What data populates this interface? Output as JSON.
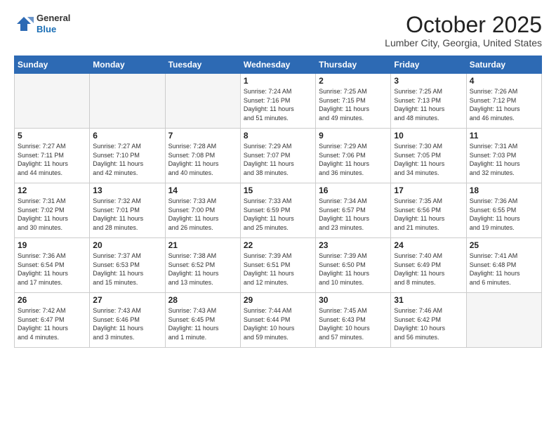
{
  "header": {
    "logo": {
      "general": "General",
      "blue": "Blue"
    },
    "title": "October 2025",
    "location": "Lumber City, Georgia, United States"
  },
  "days_of_week": [
    "Sunday",
    "Monday",
    "Tuesday",
    "Wednesday",
    "Thursday",
    "Friday",
    "Saturday"
  ],
  "weeks": [
    [
      {
        "day": "",
        "info": ""
      },
      {
        "day": "",
        "info": ""
      },
      {
        "day": "",
        "info": ""
      },
      {
        "day": "1",
        "info": "Sunrise: 7:24 AM\nSunset: 7:16 PM\nDaylight: 11 hours\nand 51 minutes."
      },
      {
        "day": "2",
        "info": "Sunrise: 7:25 AM\nSunset: 7:15 PM\nDaylight: 11 hours\nand 49 minutes."
      },
      {
        "day": "3",
        "info": "Sunrise: 7:25 AM\nSunset: 7:13 PM\nDaylight: 11 hours\nand 48 minutes."
      },
      {
        "day": "4",
        "info": "Sunrise: 7:26 AM\nSunset: 7:12 PM\nDaylight: 11 hours\nand 46 minutes."
      }
    ],
    [
      {
        "day": "5",
        "info": "Sunrise: 7:27 AM\nSunset: 7:11 PM\nDaylight: 11 hours\nand 44 minutes."
      },
      {
        "day": "6",
        "info": "Sunrise: 7:27 AM\nSunset: 7:10 PM\nDaylight: 11 hours\nand 42 minutes."
      },
      {
        "day": "7",
        "info": "Sunrise: 7:28 AM\nSunset: 7:08 PM\nDaylight: 11 hours\nand 40 minutes."
      },
      {
        "day": "8",
        "info": "Sunrise: 7:29 AM\nSunset: 7:07 PM\nDaylight: 11 hours\nand 38 minutes."
      },
      {
        "day": "9",
        "info": "Sunrise: 7:29 AM\nSunset: 7:06 PM\nDaylight: 11 hours\nand 36 minutes."
      },
      {
        "day": "10",
        "info": "Sunrise: 7:30 AM\nSunset: 7:05 PM\nDaylight: 11 hours\nand 34 minutes."
      },
      {
        "day": "11",
        "info": "Sunrise: 7:31 AM\nSunset: 7:03 PM\nDaylight: 11 hours\nand 32 minutes."
      }
    ],
    [
      {
        "day": "12",
        "info": "Sunrise: 7:31 AM\nSunset: 7:02 PM\nDaylight: 11 hours\nand 30 minutes."
      },
      {
        "day": "13",
        "info": "Sunrise: 7:32 AM\nSunset: 7:01 PM\nDaylight: 11 hours\nand 28 minutes."
      },
      {
        "day": "14",
        "info": "Sunrise: 7:33 AM\nSunset: 7:00 PM\nDaylight: 11 hours\nand 26 minutes."
      },
      {
        "day": "15",
        "info": "Sunrise: 7:33 AM\nSunset: 6:59 PM\nDaylight: 11 hours\nand 25 minutes."
      },
      {
        "day": "16",
        "info": "Sunrise: 7:34 AM\nSunset: 6:57 PM\nDaylight: 11 hours\nand 23 minutes."
      },
      {
        "day": "17",
        "info": "Sunrise: 7:35 AM\nSunset: 6:56 PM\nDaylight: 11 hours\nand 21 minutes."
      },
      {
        "day": "18",
        "info": "Sunrise: 7:36 AM\nSunset: 6:55 PM\nDaylight: 11 hours\nand 19 minutes."
      }
    ],
    [
      {
        "day": "19",
        "info": "Sunrise: 7:36 AM\nSunset: 6:54 PM\nDaylight: 11 hours\nand 17 minutes."
      },
      {
        "day": "20",
        "info": "Sunrise: 7:37 AM\nSunset: 6:53 PM\nDaylight: 11 hours\nand 15 minutes."
      },
      {
        "day": "21",
        "info": "Sunrise: 7:38 AM\nSunset: 6:52 PM\nDaylight: 11 hours\nand 13 minutes."
      },
      {
        "day": "22",
        "info": "Sunrise: 7:39 AM\nSunset: 6:51 PM\nDaylight: 11 hours\nand 12 minutes."
      },
      {
        "day": "23",
        "info": "Sunrise: 7:39 AM\nSunset: 6:50 PM\nDaylight: 11 hours\nand 10 minutes."
      },
      {
        "day": "24",
        "info": "Sunrise: 7:40 AM\nSunset: 6:49 PM\nDaylight: 11 hours\nand 8 minutes."
      },
      {
        "day": "25",
        "info": "Sunrise: 7:41 AM\nSunset: 6:48 PM\nDaylight: 11 hours\nand 6 minutes."
      }
    ],
    [
      {
        "day": "26",
        "info": "Sunrise: 7:42 AM\nSunset: 6:47 PM\nDaylight: 11 hours\nand 4 minutes."
      },
      {
        "day": "27",
        "info": "Sunrise: 7:43 AM\nSunset: 6:46 PM\nDaylight: 11 hours\nand 3 minutes."
      },
      {
        "day": "28",
        "info": "Sunrise: 7:43 AM\nSunset: 6:45 PM\nDaylight: 11 hours\nand 1 minute."
      },
      {
        "day": "29",
        "info": "Sunrise: 7:44 AM\nSunset: 6:44 PM\nDaylight: 10 hours\nand 59 minutes."
      },
      {
        "day": "30",
        "info": "Sunrise: 7:45 AM\nSunset: 6:43 PM\nDaylight: 10 hours\nand 57 minutes."
      },
      {
        "day": "31",
        "info": "Sunrise: 7:46 AM\nSunset: 6:42 PM\nDaylight: 10 hours\nand 56 minutes."
      },
      {
        "day": "",
        "info": ""
      }
    ]
  ]
}
